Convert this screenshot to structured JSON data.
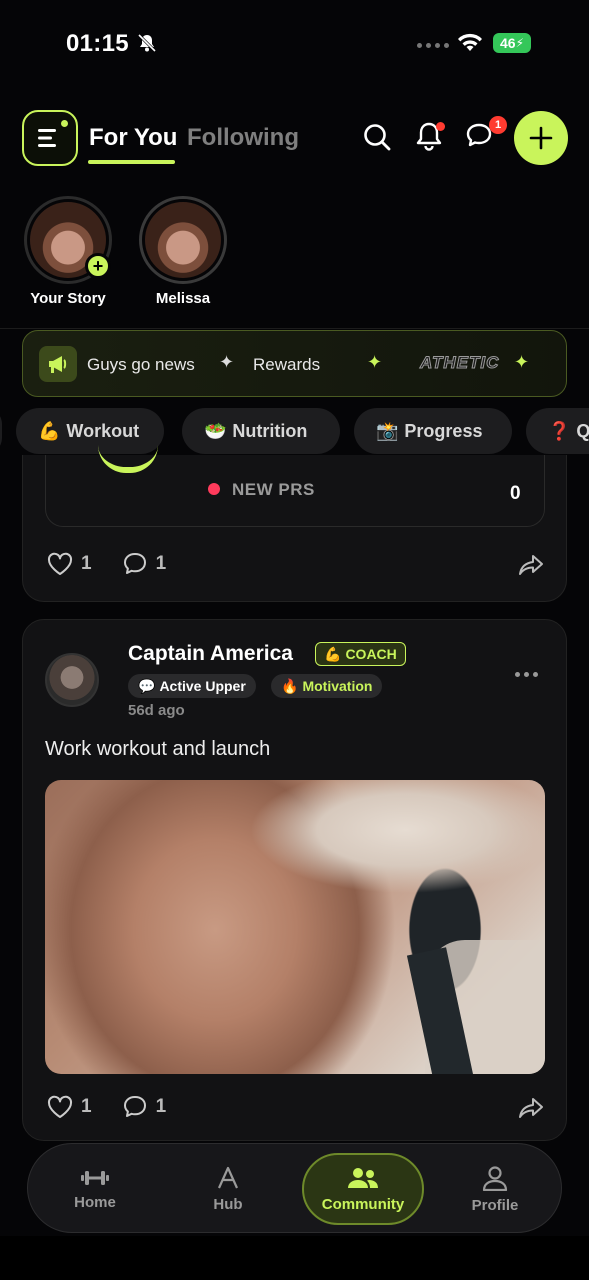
{
  "status_bar": {
    "time": "01:15",
    "battery": "46"
  },
  "header": {
    "tab_for_you": "For You",
    "tab_following": "Following",
    "messages_badge": "1",
    "accent_color": "#c9f45b"
  },
  "stories": [
    {
      "label": "Your Story"
    },
    {
      "label": "Melissa"
    }
  ],
  "banner": {
    "item1": "Guys go news",
    "item2": "Rewards",
    "brand": "ATHETIC"
  },
  "categories": [
    {
      "emoji": "💪",
      "label": "Workout"
    },
    {
      "emoji": "🥗",
      "label": "Nutrition"
    },
    {
      "emoji": "📸",
      "label": "Progress"
    },
    {
      "emoji": "❓",
      "label": "Q"
    }
  ],
  "post1": {
    "prs_label": "NEW PRS",
    "prs_count": "0",
    "likes": "1",
    "comments": "1"
  },
  "post2": {
    "author": "Captain America",
    "badge": "COACH",
    "badge_emoji": "💪",
    "tag1": "Active Upper",
    "tag1_emoji": "💬",
    "tag2": "Motivation",
    "tag2_emoji": "🔥",
    "time": "56d ago",
    "text": "Work workout and launch",
    "likes": "1",
    "comments": "1"
  },
  "nav": {
    "home": "Home",
    "hub": "Hub",
    "community": "Community",
    "profile": "Profile"
  }
}
